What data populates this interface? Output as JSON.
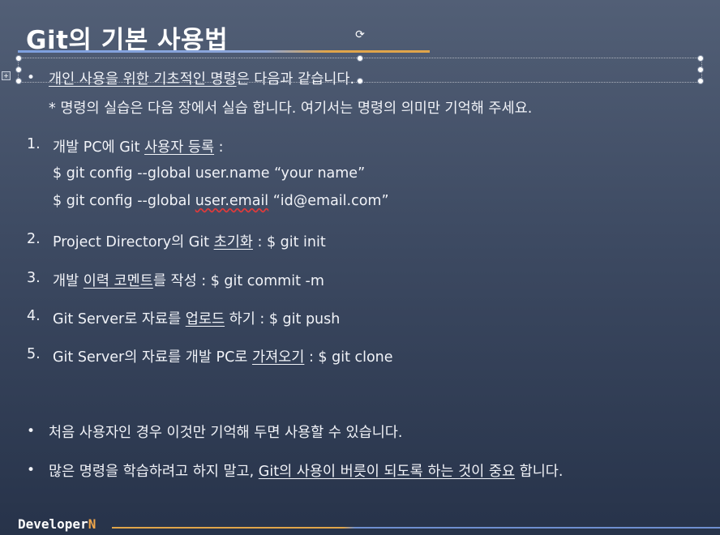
{
  "slide": {
    "title": "Git의 기본 사용법",
    "intro_bullet": "•",
    "intro_prefix": "개인 사용을 위한 기초적인 명령",
    "intro_suffix": "은 다음과 같습니다.",
    "note": "* 명령의 실습은 다음 장에서 실습 합니다. 여기서는 명령의 의미만 기억해 주세요.",
    "items": [
      {
        "number": "1.",
        "parts": [
          "개발 PC에 Git ",
          "사용자 등록",
          " :"
        ],
        "sub": [
          "$ git config --global user.name “your name”",
          [
            "$ git config --global ",
            "user.email",
            " “id@email.com”"
          ]
        ]
      },
      {
        "number": "2.",
        "parts": [
          "Project Directory의 Git ",
          "초기화",
          " : $ git init"
        ]
      },
      {
        "number": "3.",
        "parts": [
          "개발 ",
          "이력 코멘트",
          "를 작성 : $ git commit -m"
        ]
      },
      {
        "number": "4.",
        "parts": [
          "Git Server로 자료를 ",
          "업로드",
          " 하기 : $ git push"
        ]
      },
      {
        "number": "5.",
        "parts": [
          "Git Server의 자료를 개발 PC로 ",
          "가져오기",
          " : $ git clone"
        ]
      }
    ],
    "bottom_bullets": [
      "처음 사용자인 경우 이것만 기억해 두면 사용할 수 있습니다.",
      [
        "많은 명령을 학습하려고 하지 말고, ",
        "Git의 사용이 버릇이 되도록 하는 것이 중요",
        " 합니다."
      ]
    ],
    "footer": {
      "brand": "Developer",
      "brand_accent": "N"
    }
  },
  "colors": {
    "accent_orange": "#e0a54a",
    "accent_blue": "#7da0e0",
    "spell_underline": "#e03a3a"
  },
  "icons": [
    "rotate-handle-icon",
    "selection-handle-icon",
    "slide-marker-icon"
  ]
}
